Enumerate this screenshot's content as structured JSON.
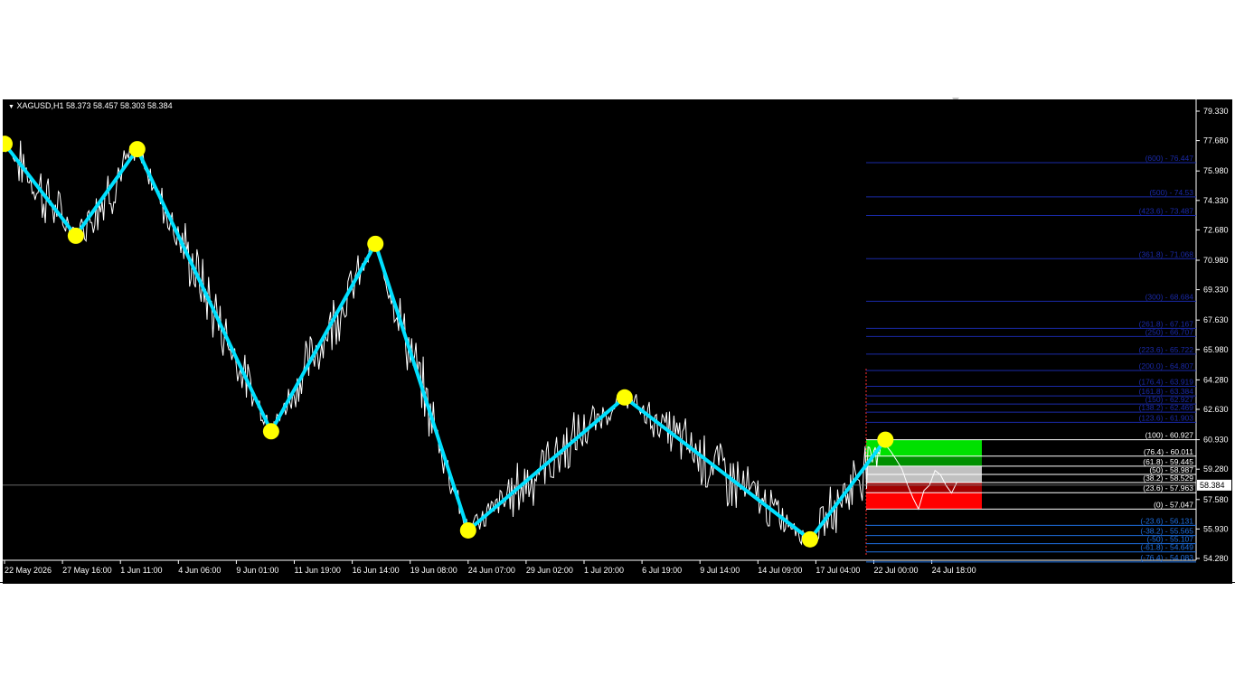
{
  "header": {
    "symbol_text": "XAGUSD,H1  58.373 58.457 58.303 58.384",
    "current_price": "58.384"
  },
  "price_axis": {
    "ticks": [
      "79.330",
      "77.680",
      "75.980",
      "74.330",
      "72.680",
      "70.980",
      "69.330",
      "67.630",
      "65.980",
      "64.280",
      "62.630",
      "60.930",
      "59.280",
      "57.580",
      "55.930",
      "54.280"
    ]
  },
  "time_axis": {
    "ticks": [
      "22 May 2026",
      "27 May 16:00",
      "1 Jun 11:00",
      "4 Jun 06:00",
      "9 Jun 01:00",
      "11 Jun 19:00",
      "16 Jun 14:00",
      "19 Jun 08:00",
      "24 Jun 07:00",
      "29 Jun 02:00",
      "1 Jul 20:00",
      "6 Jul 19:00",
      "9 Jul 14:00",
      "14 Jul 09:00",
      "17 Jul 04:00",
      "22 Jul 00:00",
      "24 Jul 18:00"
    ]
  },
  "fibonacci": {
    "levels": [
      {
        "label": "(100) - 60.927",
        "price": 60.927,
        "color": "#ffffff"
      },
      {
        "label": "(76.4) - 60.011",
        "price": 60.011,
        "color": "#ffffff"
      },
      {
        "label": "(61.8) - 59.445",
        "price": 59.445,
        "color": "#ffffff"
      },
      {
        "label": "(50) - 58.987",
        "price": 58.987,
        "color": "#ffffff"
      },
      {
        "label": "(38.2) - 58.529",
        "price": 58.529,
        "color": "#ffffff"
      },
      {
        "label": "(23.6) - 57.963",
        "price": 57.963,
        "color": "#ffffff"
      },
      {
        "label": "(0) - 57.047",
        "price": 57.047,
        "color": "#ffffff"
      },
      {
        "label": "(-23.6) - 56.131",
        "price": 56.131,
        "color": "#1e6fe0"
      },
      {
        "label": "(-38.2) - 55.565",
        "price": 55.565,
        "color": "#1e6fe0"
      },
      {
        "label": "(-50) - 55.107",
        "price": 55.107,
        "color": "#1e6fe0"
      },
      {
        "label": "(-61.8) - 54.649",
        "price": 54.649,
        "color": "#1e6fe0"
      },
      {
        "label": "(-76.4) - 54.083",
        "price": 54.083,
        "color": "#1e6fe0"
      },
      {
        "label": "(600) - 76.447",
        "price": 76.447,
        "color": "#1a2aa8"
      },
      {
        "label": "(500) - 74.53",
        "price": 74.53,
        "color": "#1a2aa8"
      },
      {
        "label": "(423.6) - 73.487",
        "price": 73.487,
        "color": "#1a2aa8"
      },
      {
        "label": "(361.8) - 71.068",
        "price": 71.068,
        "color": "#1a2aa8"
      },
      {
        "label": "(300) - 68.684",
        "price": 68.684,
        "color": "#1a2aa8"
      },
      {
        "label": "(261.8) - 67.167",
        "price": 67.167,
        "color": "#1a2aa8"
      },
      {
        "label": "(250) - 66.707",
        "price": 66.707,
        "color": "#1a2aa8"
      },
      {
        "label": "(223.6) - 65.722",
        "price": 65.722,
        "color": "#1a2aa8"
      },
      {
        "label": "(200.0) - 64.807",
        "price": 64.807,
        "color": "#1a2aa8"
      },
      {
        "label": "(176.4) - 63.919",
        "price": 63.919,
        "color": "#1a2aa8"
      },
      {
        "label": "(161.8) - 63.384",
        "price": 63.384,
        "color": "#1a2aa8"
      },
      {
        "label": "(150) - 62.927",
        "price": 62.927,
        "color": "#1a2aa8"
      },
      {
        "label": "(138.2) - 62.469",
        "price": 62.469,
        "color": "#1a2aa8"
      },
      {
        "label": "(123.6) - 61.903",
        "price": 61.903,
        "color": "#1a2aa8"
      }
    ],
    "zones": [
      {
        "name": "buy-zone-upper",
        "top": 60.927,
        "bottom": 60.011,
        "color": "#00e000"
      },
      {
        "name": "buy-zone-lower",
        "top": 60.011,
        "bottom": 59.445,
        "color": "#009000"
      },
      {
        "name": "neutral-zone",
        "top": 59.445,
        "bottom": 58.529,
        "color": "#c0c0c0"
      },
      {
        "name": "sell-zone-upper",
        "top": 58.529,
        "bottom": 57.963,
        "color": "#a00000"
      },
      {
        "name": "sell-zone-lower",
        "top": 57.963,
        "bottom": 57.047,
        "color": "#ff0000"
      }
    ]
  },
  "zigzag": {
    "color": "#00e0ff",
    "pivot_color": "#ffff00",
    "pivots": [
      {
        "t": 0.0,
        "p": 77.5
      },
      {
        "t": 1.23,
        "p": 72.35
      },
      {
        "t": 2.29,
        "p": 77.2
      },
      {
        "t": 4.6,
        "p": 61.4
      },
      {
        "t": 6.4,
        "p": 71.9
      },
      {
        "t": 8.0,
        "p": 55.85
      },
      {
        "t": 10.7,
        "p": 63.3
      },
      {
        "t": 13.9,
        "p": 55.35
      },
      {
        "t": 15.2,
        "p": 60.93
      }
    ]
  },
  "colors": {
    "background": "#000000",
    "price_line": "#ffffff",
    "axis_text": "#ffffff"
  }
}
